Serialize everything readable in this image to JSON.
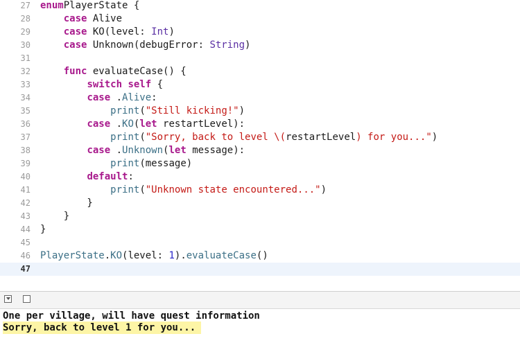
{
  "editor": {
    "lines": [
      {
        "n": "27",
        "t": [
          [
            "kw",
            "enum"
          ],
          [
            "",
            "PlayerState {"
          ]
        ]
      },
      {
        "n": "28",
        "t": [
          [
            "",
            "    "
          ],
          [
            "kw",
            "case"
          ],
          [
            "",
            " Alive"
          ]
        ]
      },
      {
        "n": "29",
        "t": [
          [
            "",
            "    "
          ],
          [
            "kw",
            "case"
          ],
          [
            "",
            " KO(level: "
          ],
          [
            "ty",
            "Int"
          ],
          [
            "",
            ")"
          ]
        ]
      },
      {
        "n": "30",
        "t": [
          [
            "",
            "    "
          ],
          [
            "kw",
            "case"
          ],
          [
            "",
            " Unknown(debugError: "
          ],
          [
            "ty",
            "String"
          ],
          [
            "",
            ")"
          ]
        ]
      },
      {
        "n": "31",
        "t": []
      },
      {
        "n": "32",
        "t": [
          [
            "",
            "    "
          ],
          [
            "kw",
            "func"
          ],
          [
            "",
            " evaluateCase() {"
          ]
        ]
      },
      {
        "n": "33",
        "t": [
          [
            "",
            "        "
          ],
          [
            "kw",
            "switch self"
          ],
          [
            "",
            " {"
          ]
        ]
      },
      {
        "n": "34",
        "t": [
          [
            "",
            "        "
          ],
          [
            "kw",
            "case"
          ],
          [
            "",
            " ."
          ],
          [
            "fn",
            "Alive"
          ],
          [
            "",
            ":"
          ]
        ]
      },
      {
        "n": "35",
        "t": [
          [
            "",
            "            "
          ],
          [
            "fn",
            "print"
          ],
          [
            "",
            "("
          ],
          [
            "str",
            "\"Still kicking!\""
          ],
          [
            "",
            ")"
          ]
        ]
      },
      {
        "n": "36",
        "t": [
          [
            "",
            "        "
          ],
          [
            "kw",
            "case"
          ],
          [
            "",
            " ."
          ],
          [
            "fn",
            "KO"
          ],
          [
            "",
            "("
          ],
          [
            "kw",
            "let"
          ],
          [
            "",
            " restartLevel):"
          ]
        ]
      },
      {
        "n": "37",
        "t": [
          [
            "",
            "            "
          ],
          [
            "fn",
            "print"
          ],
          [
            "",
            "("
          ],
          [
            "str",
            "\"Sorry, back to level \\("
          ],
          [
            "",
            "restartLevel"
          ],
          [
            "str",
            ") for you...\""
          ],
          [
            "",
            ")"
          ]
        ]
      },
      {
        "n": "38",
        "t": [
          [
            "",
            "        "
          ],
          [
            "kw",
            "case"
          ],
          [
            "",
            " ."
          ],
          [
            "fn",
            "Unknown"
          ],
          [
            "",
            "("
          ],
          [
            "kw",
            "let"
          ],
          [
            "",
            " message):"
          ]
        ]
      },
      {
        "n": "39",
        "t": [
          [
            "",
            "            "
          ],
          [
            "fn",
            "print"
          ],
          [
            "",
            "(message)"
          ]
        ]
      },
      {
        "n": "40",
        "t": [
          [
            "",
            "        "
          ],
          [
            "kw",
            "default"
          ],
          [
            "",
            ":"
          ]
        ]
      },
      {
        "n": "41",
        "t": [
          [
            "",
            "            "
          ],
          [
            "fn",
            "print"
          ],
          [
            "",
            "("
          ],
          [
            "str",
            "\"Unknown state encountered...\""
          ],
          [
            "",
            ")"
          ]
        ]
      },
      {
        "n": "42",
        "t": [
          [
            "",
            "        }"
          ]
        ]
      },
      {
        "n": "43",
        "t": [
          [
            "",
            "    }"
          ]
        ]
      },
      {
        "n": "44",
        "t": [
          [
            "",
            "}"
          ]
        ]
      },
      {
        "n": "45",
        "t": []
      },
      {
        "n": "46",
        "t": [
          [
            "fn",
            "PlayerState"
          ],
          [
            "",
            "."
          ],
          [
            "fn",
            "KO"
          ],
          [
            "",
            "(level: "
          ],
          [
            "num",
            "1"
          ],
          [
            "",
            ")."
          ],
          [
            "fn",
            "evaluateCase"
          ],
          [
            "",
            "()"
          ]
        ]
      },
      {
        "n": "47",
        "t": [],
        "current": true
      }
    ]
  },
  "console": {
    "lines": [
      {
        "text": "One per village, will have quest information",
        "highlight": false
      },
      {
        "text": "Sorry, back to level 1 for you...",
        "highlight": true
      }
    ]
  },
  "icons": {
    "hide_debug": "hide-debug-area-icon",
    "split": "split-view-icon"
  }
}
